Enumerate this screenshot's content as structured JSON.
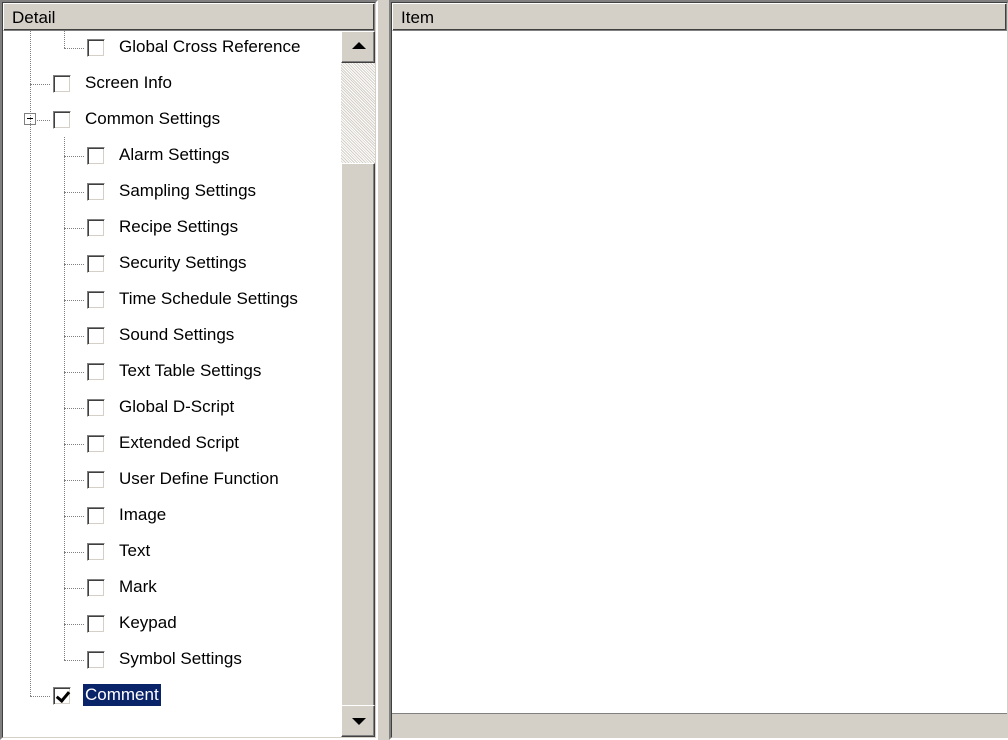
{
  "left_pane": {
    "header": "Detail",
    "tree": [
      {
        "label": "Global Cross Reference",
        "level": 1,
        "checked": false,
        "selected": false
      },
      {
        "label": "Screen Info",
        "level": 0,
        "checked": false,
        "selected": false
      },
      {
        "label": "Common Settings",
        "level": 0,
        "checked": false,
        "selected": false,
        "expanded": true
      },
      {
        "label": "Alarm Settings",
        "level": 1,
        "checked": false,
        "selected": false
      },
      {
        "label": "Sampling Settings",
        "level": 1,
        "checked": false,
        "selected": false
      },
      {
        "label": "Recipe Settings",
        "level": 1,
        "checked": false,
        "selected": false
      },
      {
        "label": "Security Settings",
        "level": 1,
        "checked": false,
        "selected": false
      },
      {
        "label": "Time Schedule Settings",
        "level": 1,
        "checked": false,
        "selected": false
      },
      {
        "label": "Sound Settings",
        "level": 1,
        "checked": false,
        "selected": false
      },
      {
        "label": "Text Table Settings",
        "level": 1,
        "checked": false,
        "selected": false
      },
      {
        "label": "Global D-Script",
        "level": 1,
        "checked": false,
        "selected": false
      },
      {
        "label": "Extended Script",
        "level": 1,
        "checked": false,
        "selected": false
      },
      {
        "label": "User Define Function",
        "level": 1,
        "checked": false,
        "selected": false
      },
      {
        "label": "Image",
        "level": 1,
        "checked": false,
        "selected": false
      },
      {
        "label": "Text",
        "level": 1,
        "checked": false,
        "selected": false
      },
      {
        "label": "Mark",
        "level": 1,
        "checked": false,
        "selected": false
      },
      {
        "label": "Keypad",
        "level": 1,
        "checked": false,
        "selected": false
      },
      {
        "label": "Symbol Settings",
        "level": 1,
        "checked": false,
        "selected": false
      },
      {
        "label": "Comment",
        "level": 0,
        "checked": true,
        "selected": true
      }
    ]
  },
  "right_pane": {
    "header": "Item"
  },
  "colors": {
    "face": "#d4d0c8",
    "selection": "#0a246a"
  }
}
